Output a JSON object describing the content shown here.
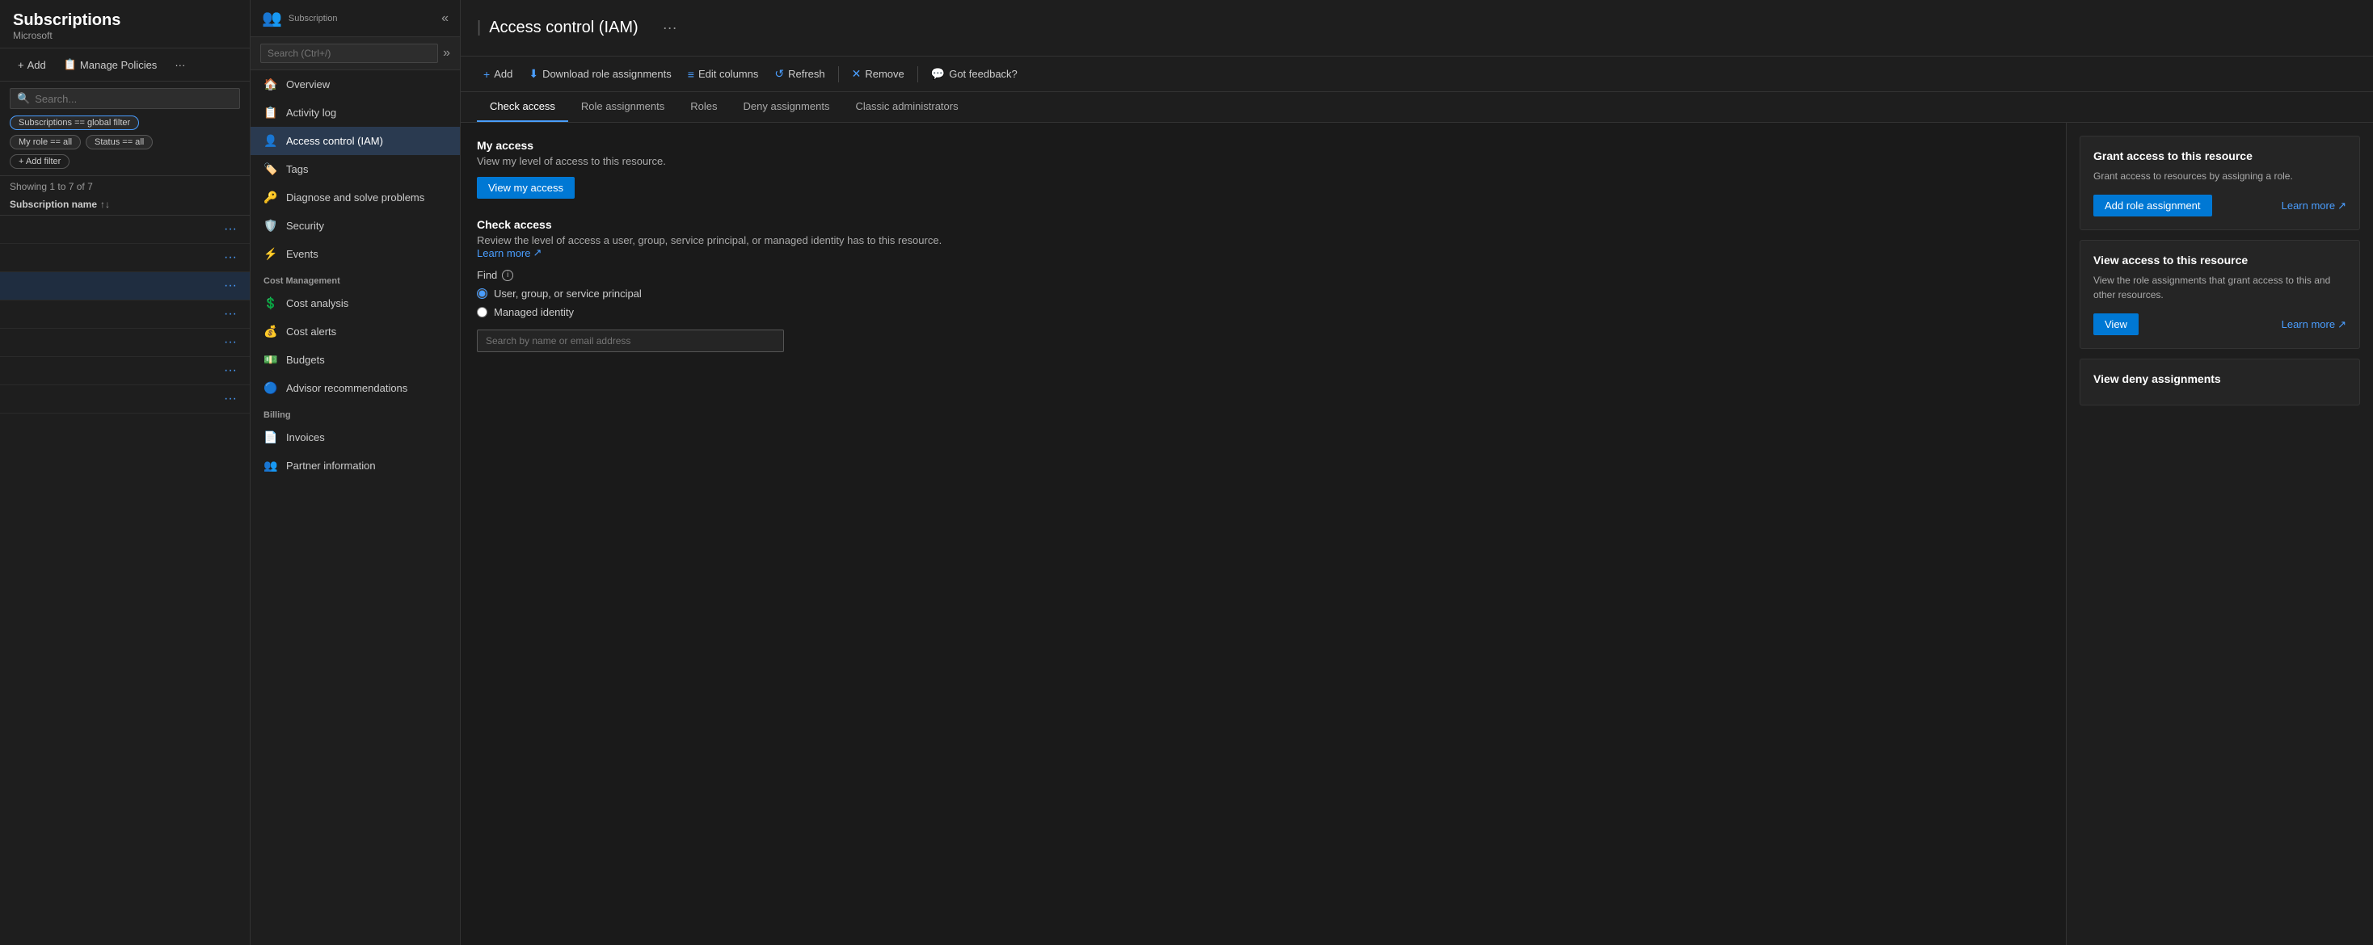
{
  "app": {
    "title": "Subscriptions",
    "subtitle": "Microsoft"
  },
  "left_toolbar": {
    "add_label": "Add",
    "manage_label": "Manage Policies",
    "more_icon": "···"
  },
  "filters": {
    "search_placeholder": "Search...",
    "global_filter_chip": "Subscriptions == global filter",
    "role_chip": "My role == all",
    "status_chip": "Status == all",
    "add_filter_label": "+ Add filter"
  },
  "table": {
    "showing": "Showing 1 to 7 of 7",
    "col_name": "Subscription name"
  },
  "rows": [
    {
      "name": "",
      "dots": "···"
    },
    {
      "name": "",
      "dots": "···"
    },
    {
      "name": "",
      "dots": "···",
      "highlight": true
    },
    {
      "name": "",
      "dots": "···"
    },
    {
      "name": "",
      "dots": "···"
    },
    {
      "name": "",
      "dots": "···"
    },
    {
      "name": "",
      "dots": "···"
    }
  ],
  "middle": {
    "icon": "👥",
    "subscription_label": "Subscription",
    "search_placeholder": "Search (Ctrl+/)",
    "nav_items": [
      {
        "label": "Overview",
        "icon": "🏠",
        "active": false
      },
      {
        "label": "Activity log",
        "icon": "📋",
        "active": false
      },
      {
        "label": "Access control (IAM)",
        "icon": "👤",
        "active": true
      },
      {
        "label": "Tags",
        "icon": "🏷️",
        "active": false
      },
      {
        "label": "Diagnose and solve problems",
        "icon": "🔑",
        "active": false
      },
      {
        "label": "Security",
        "icon": "🛡️",
        "active": false
      },
      {
        "label": "Events",
        "icon": "⚡",
        "active": false
      }
    ],
    "cost_section": "Cost Management",
    "cost_items": [
      {
        "label": "Cost analysis",
        "icon": "💲"
      },
      {
        "label": "Cost alerts",
        "icon": "💰"
      },
      {
        "label": "Budgets",
        "icon": "💵"
      },
      {
        "label": "Advisor recommendations",
        "icon": "🔵"
      }
    ],
    "billing_section": "Billing",
    "billing_items": [
      {
        "label": "Invoices",
        "icon": "📄"
      },
      {
        "label": "Partner information",
        "icon": "👥"
      }
    ]
  },
  "right_header": {
    "title": "Access control (IAM)",
    "more_icon": "···"
  },
  "toolbar": {
    "add_label": "Add",
    "download_label": "Download role assignments",
    "edit_columns_label": "Edit columns",
    "refresh_label": "Refresh",
    "remove_label": "Remove",
    "feedback_label": "Got feedback?"
  },
  "tabs": [
    {
      "label": "Check access",
      "active": true
    },
    {
      "label": "Role assignments",
      "active": false
    },
    {
      "label": "Roles",
      "active": false
    },
    {
      "label": "Deny assignments",
      "active": false
    },
    {
      "label": "Classic administrators",
      "active": false
    }
  ],
  "check_access": {
    "my_access_title": "My access",
    "my_access_desc": "View my level of access to this resource.",
    "view_my_access_btn": "View my access",
    "check_access_title": "Check access",
    "check_access_desc": "Review the level of access a user, group, service principal, or managed identity has to this resource.",
    "learn_more_text": "Learn more",
    "find_label": "Find",
    "radio_user": "User, group, or service principal",
    "radio_managed": "Managed identity",
    "search_placeholder": "Search by name or email address"
  },
  "cards": {
    "grant": {
      "title": "Grant access to this resource",
      "desc": "Grant access to resources by assigning a role.",
      "btn_label": "Add role assignment",
      "learn_more": "Learn more"
    },
    "view_access": {
      "title": "View access to this resource",
      "desc": "View the role assignments that grant access to this and other resources.",
      "btn_label": "View",
      "learn_more": "Learn more"
    },
    "deny": {
      "title": "View deny assignments"
    }
  }
}
